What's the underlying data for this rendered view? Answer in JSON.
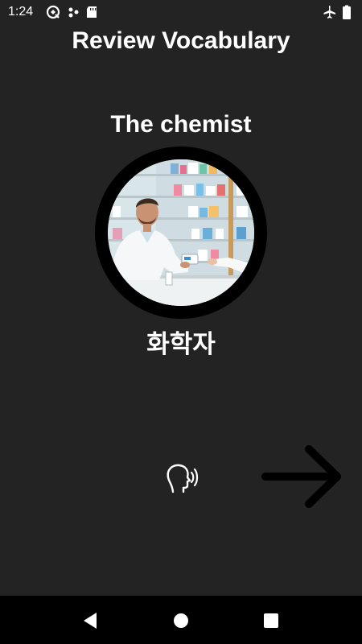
{
  "status_bar": {
    "time": "1:24",
    "left_icons": [
      "sync-icon",
      "dots-icon",
      "sd-card-icon"
    ],
    "right_icons": [
      "airplane-mode-icon",
      "battery-icon"
    ]
  },
  "screen": {
    "title": "Review Vocabulary",
    "word_english": "The chemist",
    "image": "pharmacist-photo",
    "word_korean": "화학자"
  },
  "controls": {
    "speak_icon": "speak-icon",
    "next_icon": "arrow-right-icon"
  },
  "nav_bar": {
    "icons": [
      "back-icon",
      "home-icon",
      "recents-icon"
    ]
  },
  "colors": {
    "background": "#232323",
    "text": "#ffffff",
    "ring": "#000000",
    "nav_bar": "#000000"
  }
}
